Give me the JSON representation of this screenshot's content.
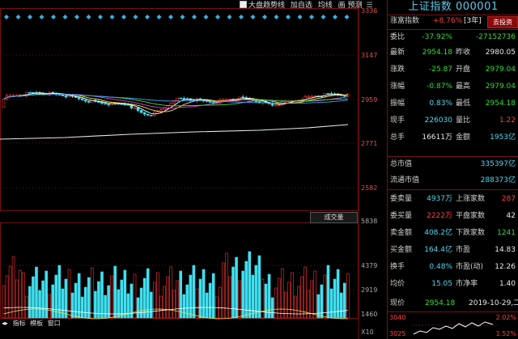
{
  "toolbar": {
    "items": [
      "大盘趋势线",
      "加自选",
      "均线",
      "画",
      "预测"
    ],
    "menu_icon": "list-icon"
  },
  "price_axis": [
    "3336",
    "3147",
    "2959",
    "2771",
    "2582"
  ],
  "volume_axis": [
    "5838",
    "4379",
    "2919",
    "1460",
    "X10"
  ],
  "volume_tab": "成交量",
  "volume_tabs": [
    "指标",
    "模板",
    "窗口"
  ],
  "panel": {
    "title": "上证指数  000001",
    "index_row": {
      "label": "涨富指数",
      "value": "+8.76%",
      "period": "[3年]",
      "button": "去投资"
    },
    "rows": [
      {
        "l1": "委比",
        "v1": "-37.92%",
        "c1": "grn",
        "l2": "",
        "v2": "-27152736",
        "c2": "grn"
      },
      {
        "l1": "最新",
        "v1": "2954.18",
        "c1": "grn",
        "l2": "昨收",
        "v2": "2980.05",
        "c2": "wht"
      },
      {
        "l1": "涨跌",
        "v1": "-25.87",
        "c1": "grn",
        "l2": "开盘",
        "v2": "2979.04",
        "c2": "grn"
      },
      {
        "l1": "涨幅",
        "v1": "-0.87%",
        "c1": "grn",
        "l2": "最高",
        "v2": "2979.04",
        "c2": "grn"
      },
      {
        "l1": "振幅",
        "v1": "0.83%",
        "c1": "cyan",
        "l2": "最低",
        "v2": "2954.18",
        "c2": "grn"
      },
      {
        "l1": "现手",
        "v1": "226030",
        "c1": "cyan",
        "l2": "量比",
        "v2": "1.22",
        "c2": "red"
      },
      {
        "l1": "总手",
        "v1": "16611万",
        "c1": "wht",
        "l2": "金额",
        "v2": "1953亿",
        "c2": "cyan"
      }
    ],
    "cap_rows": [
      {
        "label": "总市值",
        "value": "335397亿"
      },
      {
        "label": "流通市值",
        "value": "288373亿"
      }
    ],
    "order_rows": [
      {
        "l1": "委卖量",
        "v1": "4937万",
        "c1": "cyan",
        "l2": "上涨家数",
        "v2": "287",
        "c2": "red"
      },
      {
        "l1": "委买量",
        "v1": "2222万",
        "c1": "red",
        "l2": "平盘家数",
        "v2": "42",
        "c2": "wht"
      },
      {
        "l1": "卖金额",
        "v1": "408.2亿",
        "c1": "cyan",
        "l2": "下跌家数",
        "v2": "1241",
        "c2": "grn"
      },
      {
        "l1": "买金额",
        "v1": "164.4亿",
        "c1": "cyan",
        "l2": "市盈",
        "v2": "14.83",
        "c2": "wht"
      },
      {
        "l1": "换手",
        "v1": "0.48%",
        "c1": "cyan",
        "l2": "市盈(动)",
        "v2": "12.26",
        "c2": "wht"
      },
      {
        "l1": "均价",
        "v1": "15.05",
        "c1": "cyan",
        "l2": "市净率",
        "v2": "1.40",
        "c2": "wht"
      }
    ],
    "now_row": {
      "label": "现价",
      "value": "2954.18",
      "date": "2019-10-29,二"
    },
    "mini": {
      "top": "3040",
      "bottom": "3025",
      "pct_top": "2.02%",
      "pct_bottom": "1.52%"
    }
  },
  "colors": {
    "up": "#ff3030",
    "down": "#3fe0f0",
    "ma5": "#ffffff",
    "ma10": "#f0e040",
    "ma20": "#e040e0",
    "ma30": "#40e040",
    "ma60": "#40a0ff",
    "ma250": "#e8e8e8"
  }
}
